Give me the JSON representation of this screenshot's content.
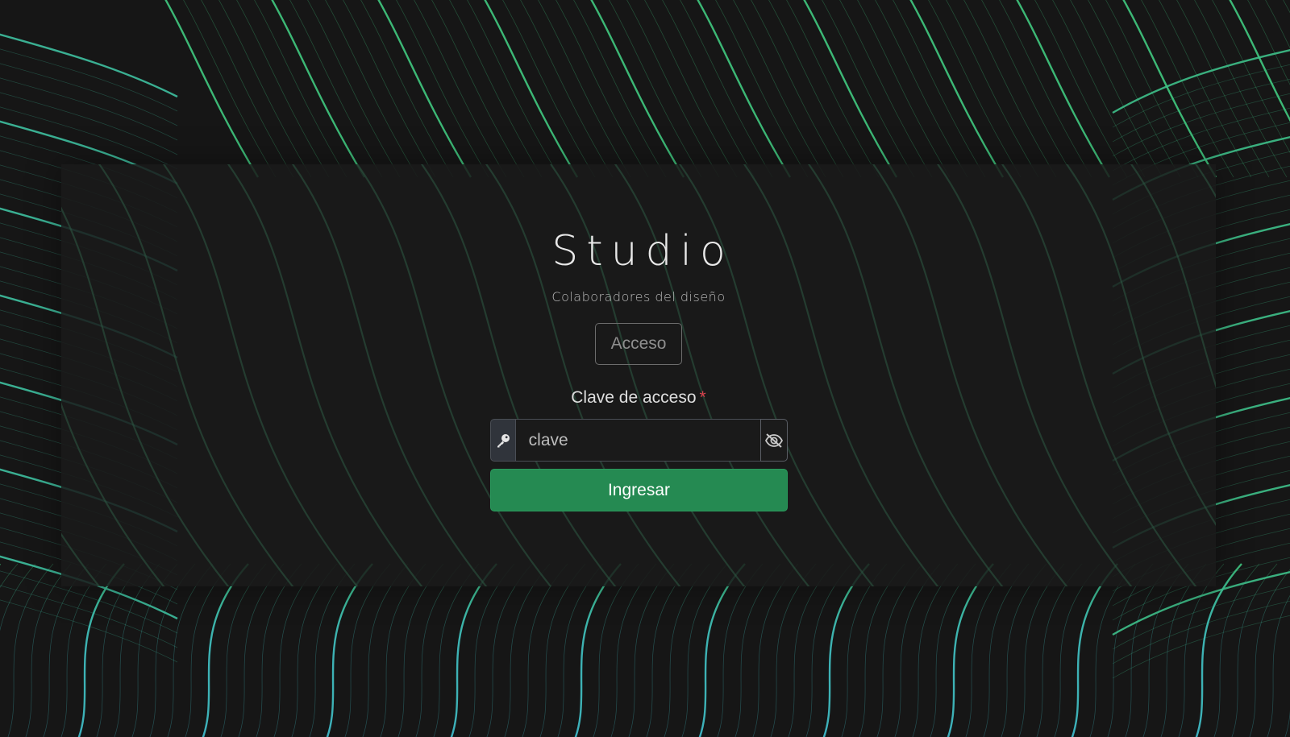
{
  "brand": {
    "title": "Studio",
    "subtitle": "Colaboradores del diseño"
  },
  "form": {
    "badge_label": "Acceso",
    "field_label": "Clave de acceso",
    "required_marker": "*",
    "password_placeholder": "clave",
    "password_value": "",
    "submit_label": "Ingresar"
  },
  "icons": {
    "left_addon": "key-icon",
    "right_addon": "eye-slash-icon"
  },
  "colors": {
    "accent_green": "#258a52",
    "line_green": "#3ec07a",
    "line_blue": "#3fb6d0",
    "required_red": "#d9414d",
    "background": "#161616"
  }
}
